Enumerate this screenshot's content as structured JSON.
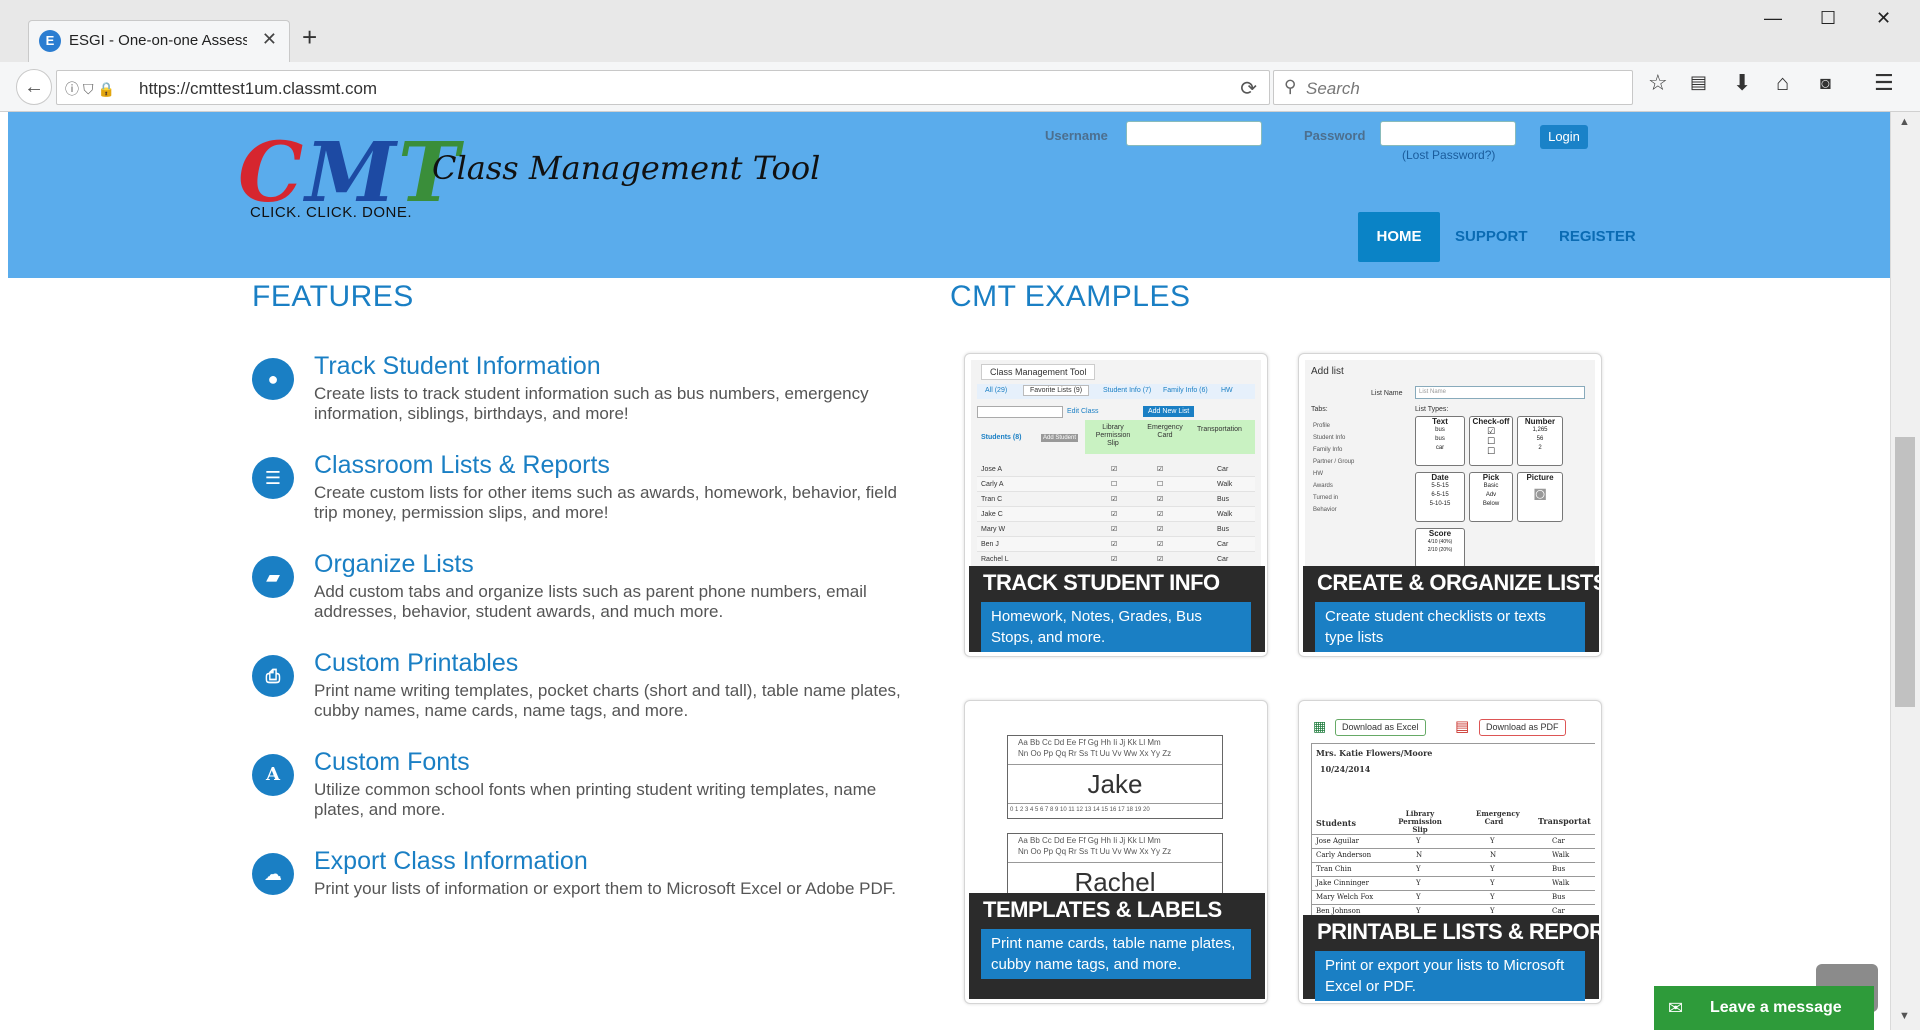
{
  "browser": {
    "tab_title": "ESGI - One-on-one Assessm",
    "url": "https://cmttest1um.classmt.com",
    "search_placeholder": "Search"
  },
  "header": {
    "logo": "CMT",
    "app_name": "Class Management Tool",
    "tagline": "CLICK. CLICK. DONE.",
    "username_label": "Username",
    "password_label": "Password",
    "login_button": "Login",
    "lost_password": "(Lost Password?)",
    "nav": [
      "HOME",
      "SUPPORT",
      "REGISTER"
    ]
  },
  "features": {
    "heading": "FEATURES",
    "items": [
      {
        "icon": "user-icon",
        "title": "Track Student Information",
        "desc": "Create lists to track student information such as bus numbers, emergency information, siblings, birthdays, and more!"
      },
      {
        "icon": "list-icon",
        "title": "Classroom Lists & Reports",
        "desc": "Create custom lists for other items such as awards, homework, behavior, field trip money, permission slips, and more!"
      },
      {
        "icon": "folder-open-icon",
        "title": "Organize Lists",
        "desc": "Add custom tabs and organize lists such as parent phone numbers, email addresses, behavior, student awards, and much more."
      },
      {
        "icon": "printer-icon",
        "title": "Custom Printables",
        "desc": "Print name writing templates, pocket charts (short and tall), table name plates, cubby names, name cards, name tags, and more."
      },
      {
        "icon": "font-icon",
        "title": "Custom Fonts",
        "desc": "Utilize common school fonts when printing student writing templates, name plates, and more."
      },
      {
        "icon": "cloud-download-icon",
        "title": "Export Class Information",
        "desc": "Print your lists of information or export them to Microsoft Excel or Adobe PDF."
      }
    ]
  },
  "examples": {
    "heading": "CMT EXAMPLES",
    "cards": [
      {
        "title": "TRACK STUDENT INFO",
        "caption": "Homework, Notes, Grades, Bus Stops, and more."
      },
      {
        "title": "CREATE & ORGANIZE LISTS",
        "caption": "Create student checklists or texts type lists"
      },
      {
        "title": "TEMPLATES & LABELS",
        "caption": "Print name cards, table name plates, cubby name tags, and more."
      },
      {
        "title": "PRINTABLE LISTS & REPORTS",
        "caption": "Print or export your lists to Microsoft Excel or PDF."
      }
    ],
    "card1_mini": {
      "app": "Class Management Tool",
      "tabs": [
        "All (29)",
        "Favorite Lists (9)",
        "Student Info (7)",
        "Family Info (6)",
        "HW"
      ],
      "edit_class": "Edit Class",
      "add_list": "Add New List",
      "students_header": "Students (8)",
      "add_student": "Add Student",
      "cols": [
        "Library Permission Slip",
        "Emergency Card",
        "Transportation"
      ],
      "rows": [
        {
          "name": "Jose A",
          "t": "Car"
        },
        {
          "name": "Carly A",
          "t": "Walk"
        },
        {
          "name": "Tran C",
          "t": "Bus"
        },
        {
          "name": "Jake C",
          "t": "Walk"
        },
        {
          "name": "Mary W",
          "t": "Bus"
        },
        {
          "name": "Ben J",
          "t": "Car"
        },
        {
          "name": "Rachel L",
          "t": "Car"
        }
      ]
    },
    "card2_mini": {
      "heading": "Add list",
      "list_name_label": "List Name",
      "list_name_placeholder": "List Name",
      "tabs_label": "Tabs:",
      "list_types_label": "List Types:",
      "tabs": [
        "Profile",
        "Student Info",
        "Family Info",
        "Partner / Group",
        "HW",
        "Awards",
        "Turned in",
        "Behavior"
      ],
      "types": [
        "Text",
        "Check-off",
        "Number",
        "Date",
        "Pick",
        "Picture",
        "Score"
      ],
      "text_vals": [
        "bus",
        "bus",
        "car"
      ],
      "number_vals": [
        "1,265",
        "56",
        "2"
      ],
      "date_vals": [
        "5-5-15",
        "6-5-15",
        "5-10-15"
      ],
      "pick_vals": [
        "Basic",
        "Adv",
        "Below"
      ],
      "score_vals": [
        "4/10 (40%)",
        "2/10 (20%)"
      ]
    },
    "card3_mini": {
      "alphabet1": "Aa Bb Cc Dd Ee Ff Gg Hh Ii Jj Kk Ll Mm",
      "alphabet2": "Nn Oo Pp Qq Rr Ss Tt Uu Vv Ww Xx Yy Zz",
      "numbers": "0 1 2 3 4 5 6 7 8 9 10 11 12 13 14 15 16 17 18 19 20",
      "name1": "Jake",
      "name2": "Rachel"
    },
    "card4_mini": {
      "excel_btn": "Download as Excel",
      "pdf_btn": "Download as PDF",
      "teacher": "Mrs. Katie Flowers/Moore",
      "date": "10/24/2014",
      "cols": [
        "Students",
        "Library Permission Slip",
        "Emergency Card",
        "Transportat"
      ],
      "rows": [
        [
          "Jose Aguilar",
          "Y",
          "Y",
          "Car"
        ],
        [
          "Carly Anderson",
          "N",
          "N",
          "Walk"
        ],
        [
          "Tran Chin",
          "Y",
          "Y",
          "Bus"
        ],
        [
          "Jake Cinninger",
          "Y",
          "Y",
          "Walk"
        ],
        [
          "Mary Welch Fox",
          "Y",
          "Y",
          "Bus"
        ],
        [
          "Ben Johnson",
          "Y",
          "Y",
          "Car"
        ]
      ]
    }
  },
  "chat": {
    "label": "Leave a message"
  }
}
